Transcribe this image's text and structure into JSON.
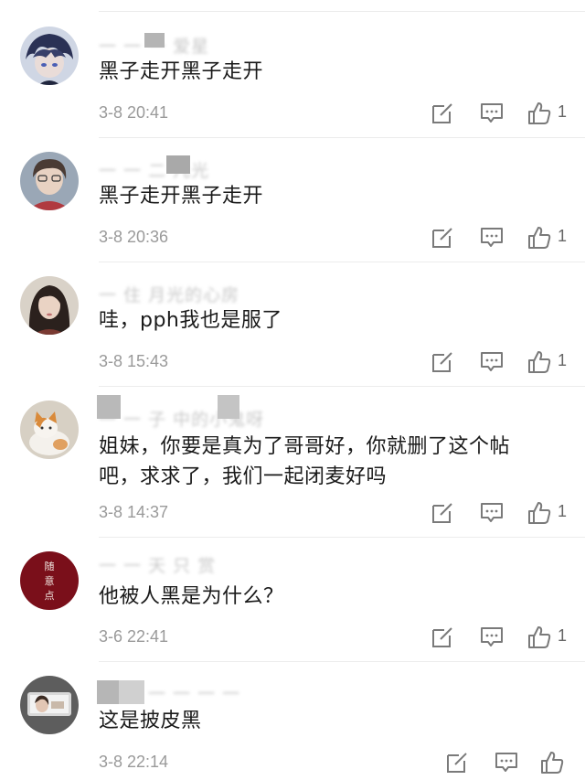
{
  "comments": [
    {
      "username": "一 一 一 爱星",
      "text": "黑子走开黑子走开",
      "time": "3-8 20:41",
      "likes": "1",
      "avatar": "anime-boy-blue"
    },
    {
      "username": "一 一 二 凡光",
      "text": "黑子走开黑子走开",
      "time": "3-8 20:36",
      "likes": "1",
      "avatar": "boy-portrait"
    },
    {
      "username": "一 住 月光的心房",
      "text": "哇，pph我也是服了",
      "time": "3-8 15:43",
      "likes": "1",
      "avatar": "girl-portrait"
    },
    {
      "username": "一 一 子 中的小鬼呀",
      "text": "姐妹，你要是真为了哥哥好，你就删了这个帖吧，求求了，我们一起闭麦好吗",
      "time": "3-8 14:37",
      "likes": "1",
      "avatar": "cat-photo"
    },
    {
      "username": "一 一 天 只 赏",
      "text": "他被人黑是为什么？",
      "time": "3-6 22:41",
      "likes": "1",
      "avatar": "red-calligraphy"
    },
    {
      "username": "一 一 一 一",
      "text": "这是披皮黑",
      "time": "3-8 22:14",
      "likes": "",
      "avatar": "car-selfie"
    }
  ],
  "avatar_text": {
    "calligraphy": [
      "随",
      "意",
      "点"
    ]
  },
  "colors": {
    "text": "#1a1a1a",
    "meta": "#9a9a9a",
    "icon": "#7a7a7a",
    "divider": "#ececec"
  }
}
